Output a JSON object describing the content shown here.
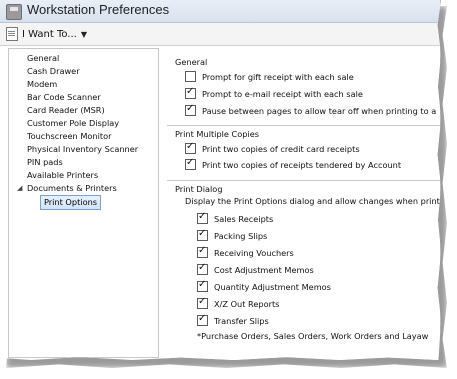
{
  "window": {
    "title": "Workstation Preferences"
  },
  "toolbar": {
    "iwantto_label": "I Want To...",
    "caret": "▼"
  },
  "nav": {
    "items": [
      {
        "label": "General"
      },
      {
        "label": "Cash Drawer"
      },
      {
        "label": "Modem"
      },
      {
        "label": "Bar Code Scanner"
      },
      {
        "label": "Card Reader (MSR)"
      },
      {
        "label": "Customer Pole Display"
      },
      {
        "label": "Touchscreen Monitor"
      },
      {
        "label": "Physical Inventory Scanner"
      },
      {
        "label": "PIN pads"
      },
      {
        "label": "Available Printers"
      },
      {
        "label": "Documents & Printers",
        "expanded": true
      },
      {
        "label": "Print Options",
        "selected": true
      }
    ],
    "expander_glyph": "◢"
  },
  "general": {
    "title": "General",
    "options": [
      {
        "label": "Prompt for gift receipt with each sale",
        "checked": false
      },
      {
        "label": "Prompt to e-mail receipt with each sale",
        "checked": true
      },
      {
        "label": "Pause between pages to allow tear off when printing to a",
        "checked": true
      }
    ]
  },
  "multiple_copies": {
    "title": "Print Multiple Copies",
    "options": [
      {
        "label": "Print two copies of credit card receipts",
        "checked": true
      },
      {
        "label": "Print two copies of receipts tendered by Account",
        "checked": true
      }
    ]
  },
  "print_dialog": {
    "title": "Print Dialog",
    "description": "Display the Print Options dialog and allow changes when printin",
    "options": [
      {
        "label": "Sales Receipts",
        "checked": true
      },
      {
        "label": "Packing Slips",
        "checked": true
      },
      {
        "label": "Receiving Vouchers",
        "checked": true
      },
      {
        "label": "Cost Adjustment Memos",
        "checked": true
      },
      {
        "label": "Quantity Adjustment Memos",
        "checked": true
      },
      {
        "label": "X/Z Out Reports",
        "checked": true
      },
      {
        "label": "Transfer Slips",
        "checked": true
      }
    ],
    "footnote": "*Purchase Orders, Sales Orders, Work Orders and Layaw"
  }
}
